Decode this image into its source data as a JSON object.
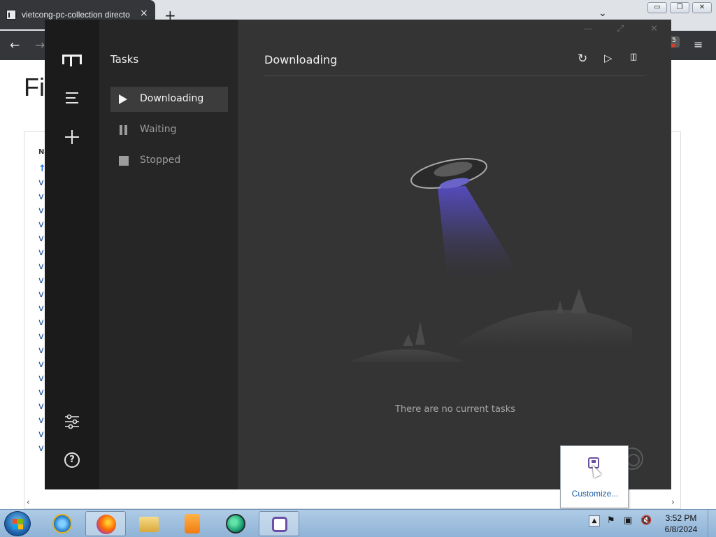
{
  "browser": {
    "tab_title": "vietcong-pc-collection directo",
    "tab_close": "×",
    "new_tab": "+",
    "tabs_dropdown": "⌄",
    "back": "←",
    "forward": "→",
    "extension_badge": "5",
    "menu": "≡",
    "page_heading": "Fi",
    "page_col_head": "Na",
    "page_rows": [
      "↑",
      "v",
      "v",
      "v",
      "v",
      "v",
      "v",
      "v",
      "v",
      "v",
      "v",
      "v",
      "v",
      "v",
      "v",
      "v",
      "v",
      "v",
      "v",
      "v",
      "v"
    ],
    "scroll_left": "‹",
    "scroll_right": "›"
  },
  "app": {
    "sub_title": "Tasks",
    "nav": {
      "menu_icon": "hamburger-icon",
      "add_icon": "plus-icon",
      "settings_icon": "sliders-icon",
      "help_icon": "?"
    },
    "task_lists": [
      {
        "label": "Downloading",
        "active": true,
        "icon": "play-icon"
      },
      {
        "label": "Waiting",
        "active": false,
        "icon": "pause-icon"
      },
      {
        "label": "Stopped",
        "active": false,
        "icon": "stop-icon"
      }
    ],
    "main_title": "Downloading",
    "toolbar": {
      "refresh": "↻",
      "resume_all": "▷",
      "pause_all": "▯▯"
    },
    "window_controls": {
      "minimize": "—",
      "maximize": "⤢",
      "close": "✕"
    },
    "empty_message": "There are no current tasks"
  },
  "tray_popup": {
    "customize_link": "Customize..."
  },
  "taskbar": {
    "clock_time": "3:52 PM",
    "clock_date": "6/8/2024"
  },
  "colors": {
    "app_bg": "#343434",
    "nav_bg": "#1b1b1b",
    "sub_bg": "#262626",
    "active_item": "#3c3c3c",
    "beam": "#5b4fd6"
  }
}
